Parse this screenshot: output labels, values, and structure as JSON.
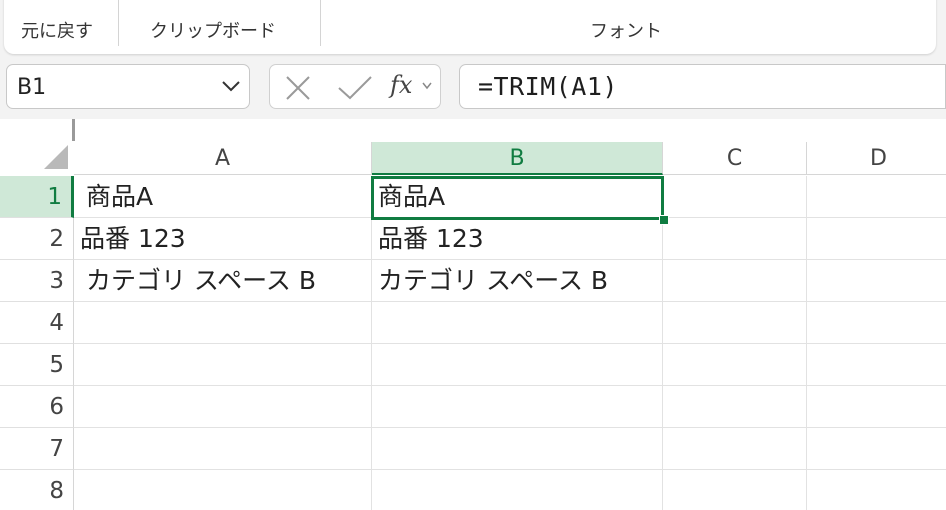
{
  "ribbon": {
    "undo_label": "元に戻す",
    "clipboard_label": "クリップボード",
    "font_label": "フォント"
  },
  "formula_bar": {
    "name_box": "B1",
    "formula": "=TRIM(A1)",
    "fx_label": "fx"
  },
  "grid": {
    "columns": [
      "A",
      "B",
      "C",
      "D"
    ],
    "rows": [
      "1",
      "2",
      "3",
      "4",
      "5",
      "6",
      "7",
      "8"
    ],
    "selected_column": "B",
    "selected_row": "1",
    "cells": {
      "A1": " 商品A",
      "B1": "商品A",
      "A2": "品番 123",
      "B2": "品番 123",
      "A3": " カテゴリ スペース B",
      "B3": "カテゴリ スペース B"
    }
  },
  "colors": {
    "accent": "#107c41",
    "selected_header_bg": "#cfe8d7"
  }
}
